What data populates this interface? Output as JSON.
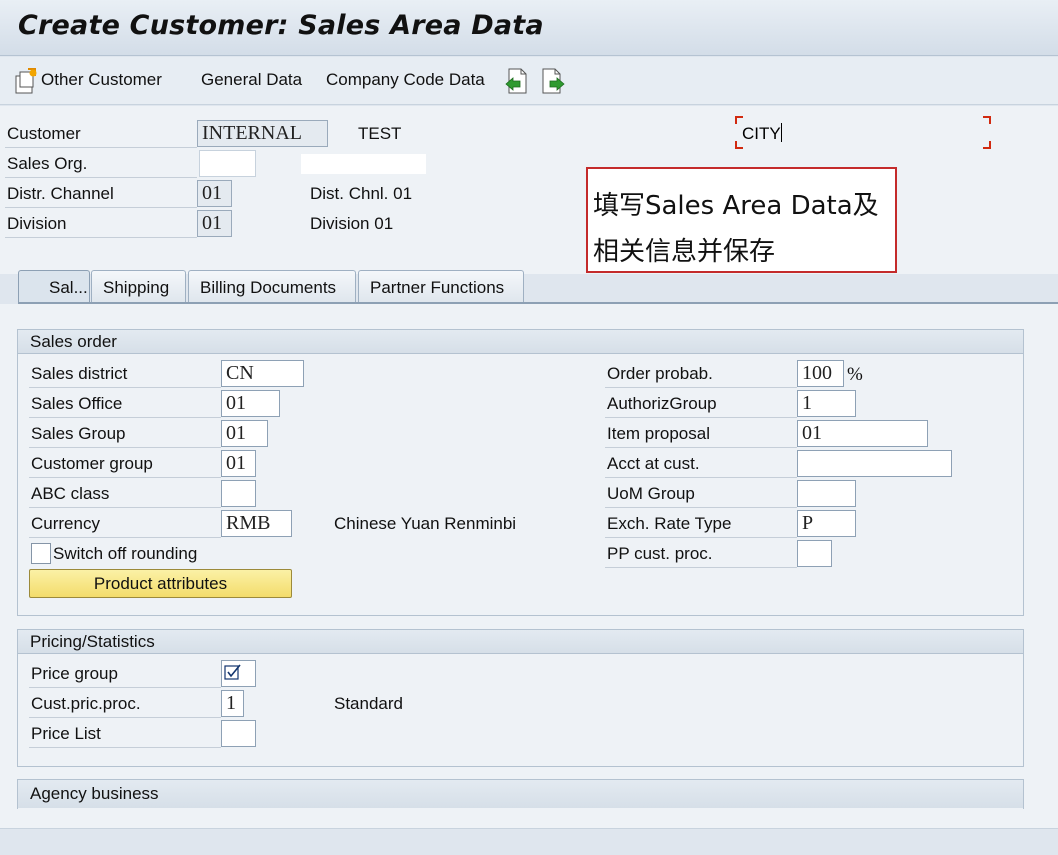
{
  "window": {
    "title": "Create Customer: Sales Area Data"
  },
  "toolbar": {
    "other_customer": "Other Customer",
    "general_data": "General Data",
    "company_code_data": "Company Code Data",
    "icons": [
      "other-customer-icon",
      "previous-screen-icon",
      "next-screen-icon"
    ]
  },
  "header": {
    "customer_label": "Customer",
    "customer_value": "INTERNAL",
    "customer_name": "TEST",
    "customer_city": "CITY",
    "sales_org_label": "Sales Org.",
    "sales_org_value": "",
    "distr_channel_label": "Distr. Channel",
    "distr_channel_value": "01",
    "distr_channel_desc": "Dist. Chnl. 01",
    "division_label": "Division",
    "division_value": "01",
    "division_desc": "Division 01"
  },
  "callout": {
    "line1": "填写Sales Area Data及",
    "line2": "相关信息并保存",
    "border_color": "#c42b2b"
  },
  "tabs": [
    {
      "label": "Sal...",
      "active": true
    },
    {
      "label": "Shipping",
      "active": false
    },
    {
      "label": "Billing Documents",
      "active": false
    },
    {
      "label": "Partner Functions",
      "active": false
    }
  ],
  "sales_order": {
    "title": "Sales order",
    "sales_district_label": "Sales district",
    "sales_district_value": "CN",
    "sales_office_label": "Sales Office",
    "sales_office_value": "01",
    "sales_group_label": "Sales Group",
    "sales_group_value": "01",
    "customer_group_label": "Customer group",
    "customer_group_value": "01",
    "abc_class_label": "ABC class",
    "abc_class_value": "",
    "currency_label": "Currency",
    "currency_value": "RMB",
    "currency_desc": "Chinese Yuan Renminbi",
    "switch_off_rounding_label": "Switch off rounding",
    "switch_off_rounding_checked": false,
    "product_attributes_button": "Product attributes",
    "order_probab_label": "Order probab.",
    "order_probab_value": "100",
    "order_probab_unit": "%",
    "authoriz_group_label": "AuthorizGroup",
    "authoriz_group_value": "1",
    "item_proposal_label": "Item proposal",
    "item_proposal_value": "01",
    "acct_at_cust_label": "Acct at cust.",
    "acct_at_cust_value": "",
    "uom_group_label": "UoM Group",
    "uom_group_value": "",
    "exch_rate_type_label": "Exch. Rate Type",
    "exch_rate_type_value": "P",
    "pp_cust_proc_label": "PP cust. proc.",
    "pp_cust_proc_value": ""
  },
  "pricing": {
    "title": "Pricing/Statistics",
    "price_group_label": "Price group",
    "price_group_checked": true,
    "cust_pric_proc_label": "Cust.pric.proc.",
    "cust_pric_proc_value": "1",
    "cust_pric_proc_desc": "Standard",
    "price_list_label": "Price List",
    "price_list_value": ""
  },
  "agency": {
    "title": "Agency business"
  },
  "colors": {
    "highlight_button": "#f3dc6b",
    "window_bg": "#dfe6ee"
  }
}
